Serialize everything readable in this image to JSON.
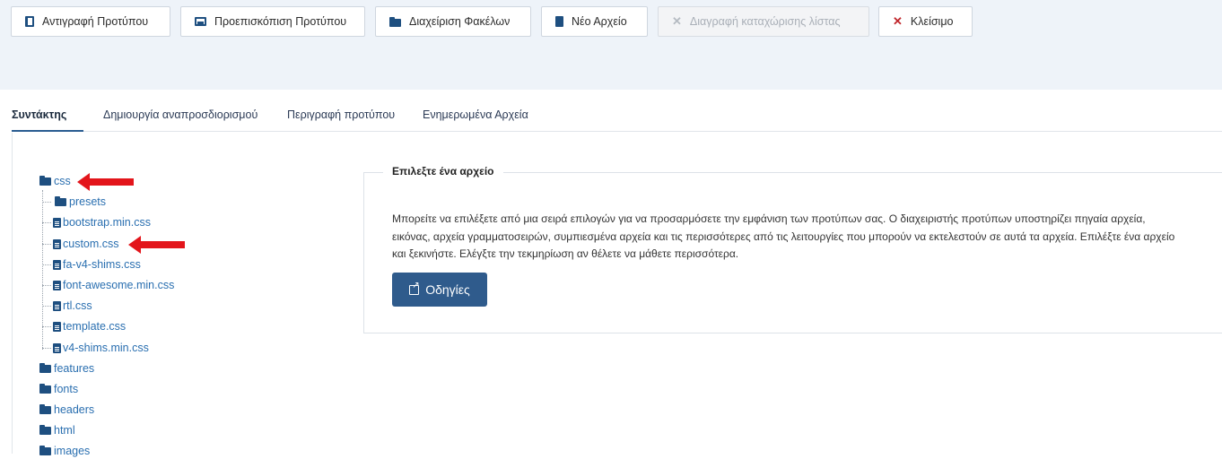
{
  "toolbar": {
    "copy_label": "Αντιγραφή Προτύπου",
    "preview_label": "Προεπισκόπιση Προτύπου",
    "folders_label": "Διαχείριση Φακέλων",
    "newfile_label": "Νέο Αρχείο",
    "delete_label": "Διαγραφή καταχώρισης λίστας",
    "close_label": "Κλείσιμο"
  },
  "tabs": [
    {
      "label": "Συντάκτης"
    },
    {
      "label": "Δημιουργία αναπροσδιορισμού"
    },
    {
      "label": "Περιγραφή προτύπου"
    },
    {
      "label": "Ενημερωμένα Αρχεία"
    }
  ],
  "tree": {
    "css": "css",
    "presets": "presets",
    "files": [
      "bootstrap.min.css",
      "custom.css",
      "fa-v4-shims.css",
      "font-awesome.min.css",
      "rtl.css",
      "template.css",
      "v4-shims.min.css"
    ],
    "folders": [
      "features",
      "fonts",
      "headers",
      "html",
      "images"
    ]
  },
  "panel": {
    "legend": "Επιλεξτε ένα αρχείο",
    "lines": [
      "Μπορείτε να επιλέξετε από μια σειρά επιλογών για να προσαρμόσετε την εμφάνιση των προτύπων σας. Ο διαχειριστής προτύπων υποστηρίζει πηγαία αρχεία,",
      "εικόνας, αρχεία γραμματοσειρών, συμπιεσμένα αρχεία και τις περισσότερες από τις λειτουργίες που μπορούν να εκτελεστούν σε αυτά τα αρχεία. Επιλέξτε ένα αρχείο",
      "και ξεκινήστε. Ελέγξτε την τεκμηρίωση αν θέλετε να μάθετε περισσότερα."
    ],
    "button_label": "Οδηγίες"
  },
  "colors": {
    "accent": "#2f5b8c",
    "icon": "#1e4f80",
    "link": "#2a6fb0",
    "arrow": "#e3151b",
    "close": "#c0262b"
  }
}
